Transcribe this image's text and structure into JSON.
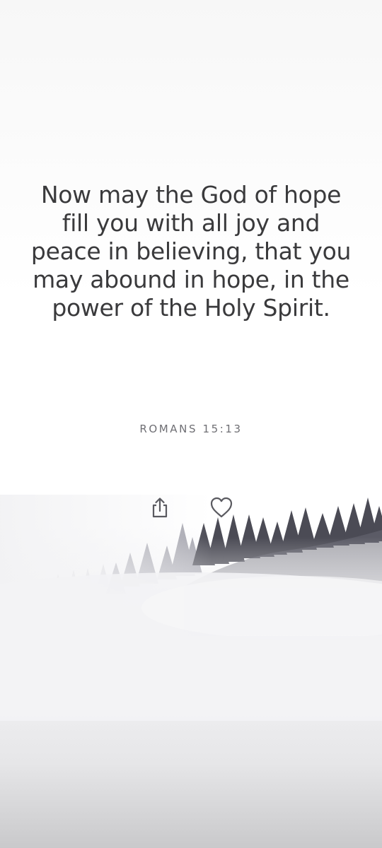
{
  "verse": {
    "text": "Now may the God of hope fill you with all joy and peace in believing, that you may abound in hope, in the power of the Holy Spirit.",
    "reference": "ROMANS 15:13"
  },
  "actions": {
    "share_icon": "share-icon",
    "like_icon": "heart-icon"
  },
  "background": {
    "image": "misty pine forest",
    "colors": {
      "text": "#3a3a3c",
      "reference": "#6f6f74",
      "icon": "#5a5a60",
      "trees": "#4b4b55"
    }
  }
}
